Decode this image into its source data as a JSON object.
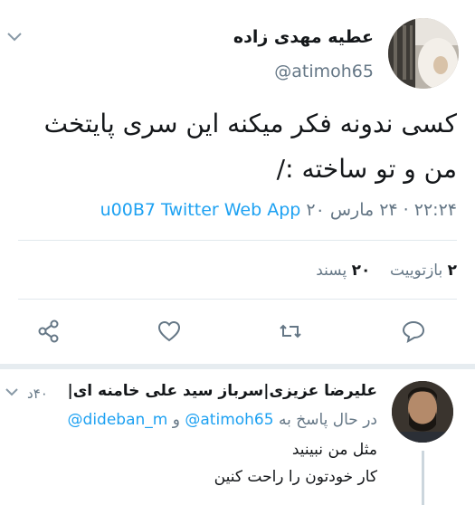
{
  "tweet": {
    "author_name": "عطیه مهدی زاده",
    "author_handle": "@atimoh65",
    "text_line1": "کسی ندونه فکر میکنه این سری پایتخث",
    "text_line2": "من و تو ساخته :/",
    "meta_time_date": "۲۲:۲۴ · ۲۴ مارس ۲۰",
    "meta_source": "u00B7 Twitter Web App",
    "retweet_count": "۲",
    "retweet_label": "بازتوییت",
    "like_count": "۲۰",
    "like_label": "پسند",
    "icons": {
      "caret": "chevron-down-icon",
      "reply": "reply-icon",
      "retweet": "retweet-icon",
      "like": "heart-icon",
      "share": "share-icon"
    }
  },
  "reply": {
    "author_name": "علیرضا عزیزی|سرباز سید علی خامنه ای|",
    "time": "۴۰د",
    "replying_prefix": "در حال پاسخ به",
    "replying_handle1": "@atimoh65",
    "replying_conj": "و",
    "replying_handle2": "@dideban_m",
    "text_line1": "مثل من نبینید",
    "text_line2": "کار خودتون را راحت کنین"
  },
  "colors": {
    "text": "#14171a",
    "secondary": "#657786",
    "link": "#1da1f2",
    "divider": "#e1e8ed"
  }
}
